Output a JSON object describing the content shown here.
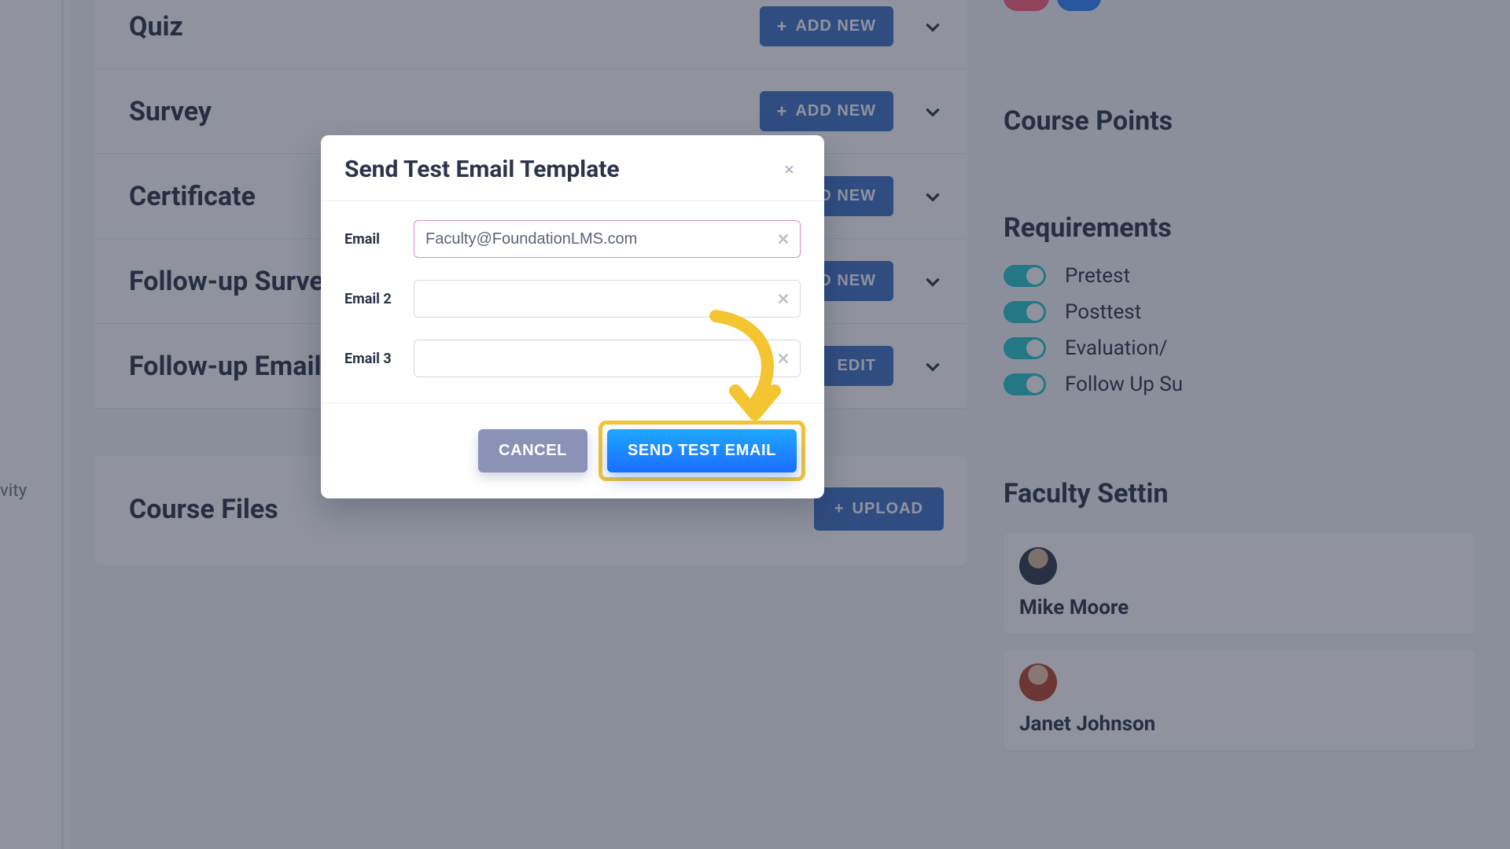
{
  "leftNav": {
    "itemLabel": "vity"
  },
  "sections": [
    {
      "title": "Quiz",
      "button": "ADD NEW"
    },
    {
      "title": "Survey",
      "button": "ADD NEW"
    },
    {
      "title": "Certificate",
      "button": "ADD NEW"
    },
    {
      "title": "Follow-up Survey",
      "button": "ADD NEW"
    },
    {
      "title": "Follow-up Email Te",
      "button": "EDIT"
    }
  ],
  "files": {
    "title": "Course Files",
    "uploadLabel": "UPLOAD"
  },
  "right": {
    "coursePoints": "Course Points",
    "requirements": "Requirements",
    "toggles": [
      "Pretest",
      "Posttest",
      "Evaluation/",
      "Follow Up Su"
    ],
    "facultySettings": "Faculty Settin",
    "faculty": [
      "Mike Moore",
      "Janet Johnson"
    ]
  },
  "modal": {
    "title": "Send Test Email Template",
    "labels": {
      "email": "Email",
      "email2": "Email 2",
      "email3": "Email 3"
    },
    "values": {
      "email": "Faculty@FoundationLMS.com",
      "email2": "",
      "email3": ""
    },
    "buttons": {
      "cancel": "CANCEL",
      "send": "SEND TEST EMAIL"
    }
  }
}
